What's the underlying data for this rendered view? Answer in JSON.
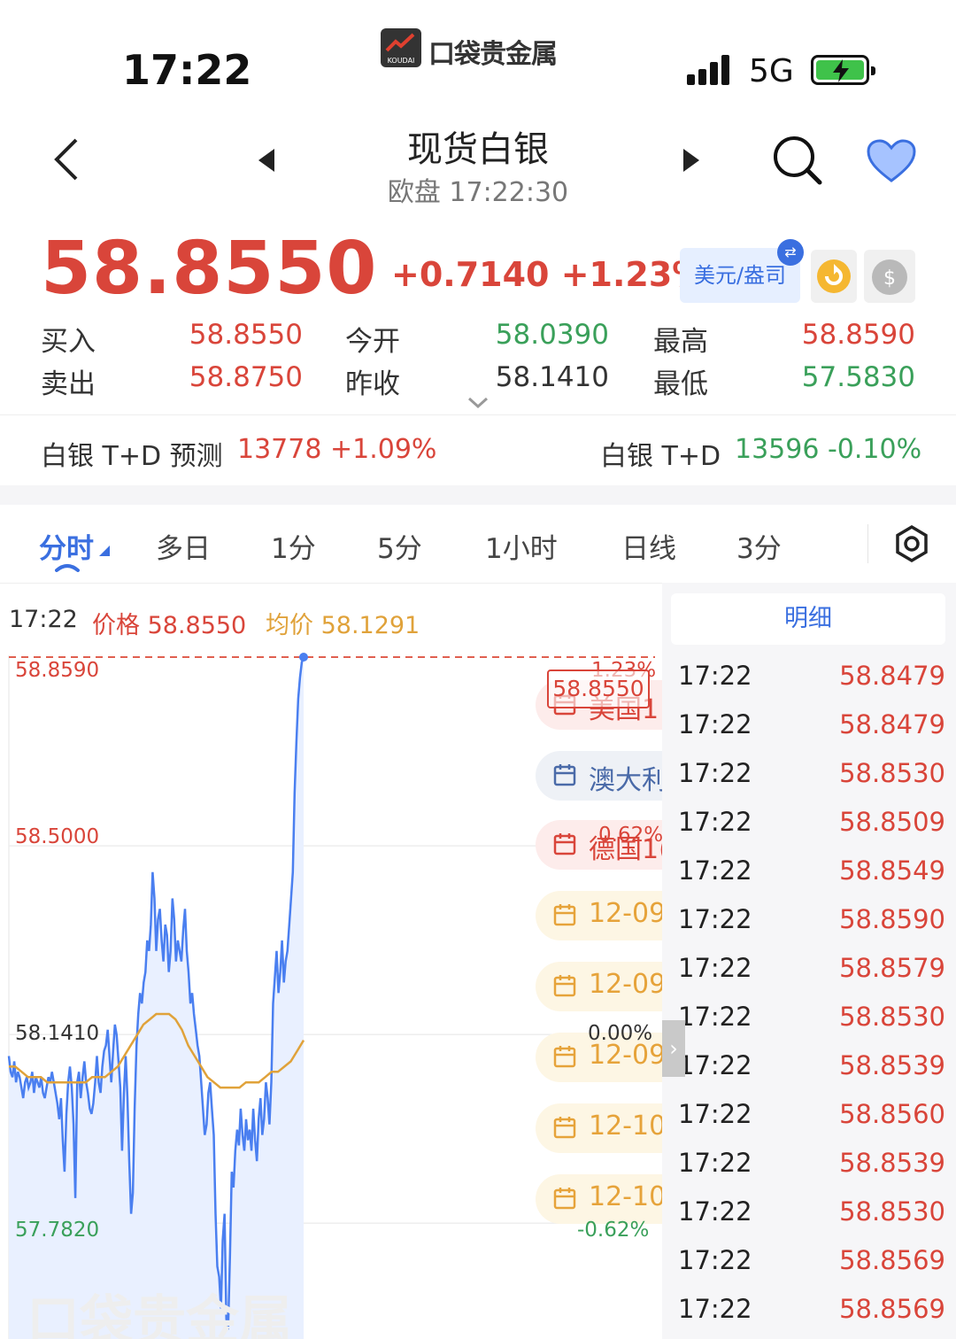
{
  "status": {
    "time": "17:22",
    "network": "5G"
  },
  "app": {
    "logo_small": "KOUDAI",
    "logo_text": "口袋贵金属"
  },
  "header": {
    "title": "现货白银",
    "subtitle": "欧盘 17:22:30"
  },
  "quote": {
    "price": "58.8550",
    "change": "+0.7140 +1.23%",
    "unit": "美元/盎司",
    "bid_label": "买入",
    "bid": "58.8550",
    "ask_label": "卖出",
    "ask": "58.8750",
    "open_label": "今开",
    "open": "58.0390",
    "prev_label": "昨收",
    "prev": "58.1410",
    "high_label": "最高",
    "high": "58.8590",
    "low_label": "最低",
    "low": "57.5830"
  },
  "td": {
    "forecast_label": "白银 T+D 预测",
    "forecast_value": "13778 +1.09%",
    "spot_label": "白银 T+D",
    "spot_value": "13596 -0.10%"
  },
  "tabs": [
    "分时",
    "多日",
    "1分",
    "5分",
    "1小时",
    "日线",
    "3分"
  ],
  "chart_info": {
    "time": "17:22",
    "price": "价格 58.8550",
    "avg": "均价 58.1291"
  },
  "chart_labels": {
    "y_top": "58.8590",
    "y_mid": "58.5000",
    "y_prev": "58.1410",
    "y_low": "57.7820",
    "pct_top": "1.23%",
    "pct_mid": "0.62%",
    "pct_zero": "0.00%",
    "pct_low": "-0.62%",
    "price_tag": "58.8550"
  },
  "events": [
    {
      "text": "美国1",
      "style": "red"
    },
    {
      "text": "澳大利",
      "style": "gray"
    },
    {
      "text": "德国1(",
      "style": "red"
    },
    {
      "text": "12-09",
      "style": "yellow"
    },
    {
      "text": "12-09",
      "style": "yellow"
    },
    {
      "text": "12-09",
      "style": "yellow"
    },
    {
      "text": "12-10",
      "style": "yellow"
    },
    {
      "text": "12-10",
      "style": "yellow"
    }
  ],
  "detail": {
    "title": "明细",
    "rows": [
      {
        "time": "17:22",
        "price": "58.8479"
      },
      {
        "time": "17:22",
        "price": "58.8479"
      },
      {
        "time": "17:22",
        "price": "58.8530"
      },
      {
        "time": "17:22",
        "price": "58.8509"
      },
      {
        "time": "17:22",
        "price": "58.8549"
      },
      {
        "time": "17:22",
        "price": "58.8590"
      },
      {
        "time": "17:22",
        "price": "58.8579"
      },
      {
        "time": "17:22",
        "price": "58.8530"
      },
      {
        "time": "17:22",
        "price": "58.8539"
      },
      {
        "time": "17:22",
        "price": "58.8560"
      },
      {
        "time": "17:22",
        "price": "58.8539"
      },
      {
        "time": "17:22",
        "price": "58.8530"
      },
      {
        "time": "17:22",
        "price": "58.8569"
      },
      {
        "time": "17:22",
        "price": "58.8569"
      }
    ]
  },
  "watermark": "口袋贵金属",
  "colors": {
    "up": "#d9453a",
    "down": "#3aa05a",
    "accent": "#3a6fe0",
    "avg_line": "#e0a23a"
  },
  "chart_data": {
    "type": "line",
    "ylim": [
      57.582,
      58.859
    ],
    "series": [
      {
        "values": [
          58.1,
          58.07,
          58.06,
          58.09,
          58.05,
          58.07,
          58.06,
          58.04,
          58.02,
          58.05,
          58.06,
          58.04,
          58.05,
          58.07,
          58.03,
          58.06,
          58.05,
          58.04,
          58.06,
          58.03,
          58.02,
          58.04,
          58.06,
          58.05,
          58.07,
          58.05,
          58.03,
          58.01,
          57.98,
          58.02,
          57.94,
          57.88,
          57.99,
          58.05,
          58.08,
          58.04,
          57.97,
          57.83,
          58.05,
          58.07,
          58.02,
          58.06,
          58.09,
          58.05,
          58.03,
          58.0,
          57.99,
          58.01,
          58.05,
          58.1,
          58.05,
          58.03,
          58.08,
          58.11,
          58.12,
          58.15,
          58.1,
          58.05,
          58.11,
          58.16,
          58.14,
          58.09,
          58.04,
          57.92,
          58.03,
          58.1,
          58.02,
          57.9,
          57.8,
          57.84,
          58.0,
          58.12,
          58.18,
          58.22,
          58.2,
          58.24,
          58.26,
          58.32,
          58.3,
          58.35,
          58.45,
          58.4,
          58.3,
          58.36,
          58.38,
          58.32,
          58.28,
          58.35,
          58.33,
          58.26,
          58.3,
          58.4,
          58.36,
          58.28,
          58.32,
          58.3,
          58.28,
          58.34,
          58.38,
          58.3,
          58.26,
          58.2,
          58.22,
          58.18,
          58.15,
          58.12,
          58.1,
          58.05,
          58.0,
          57.95,
          57.97,
          58.03,
          58.05,
          58.0,
          57.95,
          57.8,
          57.7,
          57.68,
          57.62,
          57.75,
          57.8,
          57.6,
          57.58,
          57.72,
          57.88,
          57.85,
          57.92,
          57.96,
          57.93,
          58.0,
          57.95,
          57.92,
          57.98,
          57.94,
          57.96,
          57.92,
          58.0,
          57.94,
          57.9,
          57.98,
          58.02,
          57.95,
          57.98,
          58.05,
          58.02,
          57.97,
          58.05,
          58.2,
          58.25,
          58.3,
          58.22,
          58.26,
          58.32,
          58.24,
          58.28,
          58.3,
          58.35,
          58.4,
          58.45,
          58.6,
          58.7,
          58.78,
          58.82,
          58.85,
          58.855
        ]
      },
      {
        "values": [
          58.08,
          58.08,
          58.07,
          58.06,
          58.06,
          58.06,
          58.05,
          58.05,
          58.05,
          58.05,
          58.05,
          58.05,
          58.05,
          58.06,
          58.06,
          58.06,
          58.07,
          58.08,
          58.1,
          58.12,
          58.14,
          58.16,
          58.17,
          58.18,
          58.18,
          58.18,
          58.17,
          58.15,
          58.12,
          58.1,
          58.08,
          58.06,
          58.05,
          58.04,
          58.04,
          58.04,
          58.04,
          58.05,
          58.05,
          58.05,
          58.06,
          58.07,
          58.07,
          58.08,
          58.09,
          58.11,
          58.13
        ]
      }
    ]
  }
}
